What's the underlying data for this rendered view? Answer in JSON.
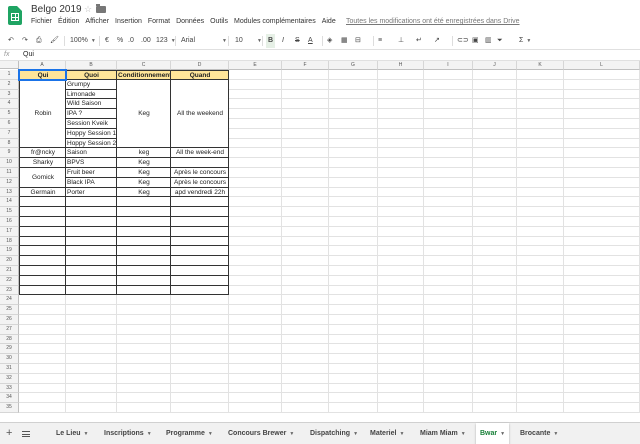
{
  "app": {
    "doc_title": "Belgo 2019",
    "menu": [
      "Fichier",
      "Édition",
      "Afficher",
      "Insertion",
      "Format",
      "Données",
      "Outils",
      "Modules complémentaires",
      "Aide"
    ],
    "save_status": "Toutes les modifications ont été enregistrées dans Drive"
  },
  "toolbar": {
    "zoom": "100%",
    "currency": "€",
    "percent": "%",
    "dec_less": ".0",
    "dec_more": ".00",
    "more_formats": "123",
    "font": "Arial",
    "font_size": "10",
    "bold": "B",
    "italic": "I",
    "strike": "S",
    "text_color": "A",
    "sum": "Σ"
  },
  "formula_bar": {
    "fx": "fx",
    "value": "Qui"
  },
  "columns": [
    "A",
    "B",
    "C",
    "D",
    "E",
    "F",
    "G",
    "H",
    "I",
    "J",
    "K",
    "L"
  ],
  "rows": [
    "1",
    "2",
    "3",
    "4",
    "5",
    "6",
    "7",
    "8",
    "9",
    "10",
    "11",
    "12",
    "13",
    "14",
    "15",
    "16",
    "17",
    "18",
    "19",
    "20",
    "21",
    "22",
    "23",
    "24",
    "25",
    "26",
    "27",
    "28",
    "29",
    "30",
    "31",
    "32",
    "33",
    "34",
    "35"
  ],
  "table": {
    "headers": [
      "Qui",
      "Quoi",
      "Conditionnement",
      "Quand"
    ],
    "groups": [
      {
        "qui": "Robin",
        "quoi": [
          "Grumpy",
          "Limonade",
          "Wild Saison",
          "IPA ?",
          "Session Kveik",
          "Hoppy Session 1",
          "Hoppy Session 2"
        ],
        "cond": "Keg",
        "quand": "All the weekend"
      },
      {
        "qui": "fr@ncky",
        "quoi": [
          "Saison"
        ],
        "cond": "keg",
        "quand": "All the week-end"
      },
      {
        "qui": "Sharky",
        "quoi": [
          "BPVS"
        ],
        "cond": "Keg",
        "quand": ""
      },
      {
        "qui": "Gomick",
        "quoi": [
          "Fruit beer",
          "Black IPA"
        ],
        "cond": "Keg",
        "quand": "Après le concours",
        "cond2": "Keg",
        "quand2": "Après le concours"
      },
      {
        "qui": "Germain",
        "quoi": [
          "Porter"
        ],
        "cond": "Keg",
        "quand": "apd vendredi 22h"
      }
    ]
  },
  "sheet_tabs": [
    {
      "label": "Le Lieu",
      "active": false
    },
    {
      "label": "Inscriptions",
      "active": false
    },
    {
      "label": "Programme",
      "active": false
    },
    {
      "label": "Concours Brewer",
      "active": false
    },
    {
      "label": "Dispatching",
      "active": false
    },
    {
      "label": "Materiel",
      "active": false
    },
    {
      "label": "Miam Miam",
      "active": false
    },
    {
      "label": "Bwar",
      "active": true
    },
    {
      "label": "Brocante",
      "active": false
    }
  ],
  "colors": {
    "header_fill": "#ffe599",
    "brand_green": "#1fa463",
    "active_tab": "#188038",
    "selection": "#1a73e8"
  }
}
